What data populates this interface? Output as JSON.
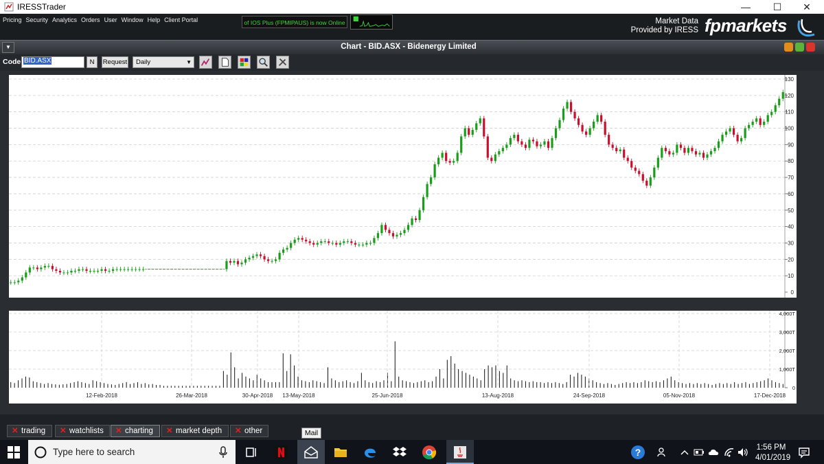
{
  "window": {
    "title": "IRESSTrader",
    "minimize": "—",
    "maximize": "☐",
    "close": "✕"
  },
  "menu": [
    "Pricing",
    "Security",
    "Analytics",
    "Orders",
    "User",
    "Window",
    "Help",
    "Client Portal"
  ],
  "status": {
    "online_text": "of IOS Plus (FPMIPAUS) is now Online"
  },
  "branding": {
    "market_data_line1": "Market Data",
    "market_data_line2": "Provided by IRESS",
    "brand": "fpmarkets"
  },
  "chart_window": {
    "title": "Chart - BID.ASX - Bidenergy Limited",
    "menu_glyph": "▼"
  },
  "toolbar": {
    "code_label": "Code:",
    "code_value": "BID.ASX",
    "n_button": "N",
    "request_button": "Request",
    "period": "Daily",
    "period_arrow": "▼"
  },
  "chart_data": [
    {
      "type": "candlestick",
      "x_tick_labels": [
        "12-Feb-2018",
        "26-Mar-2018",
        "30-Apr-2018",
        "13-May-2018",
        "25-Jun-2018",
        "13-Aug-2018",
        "24-Sep-2018",
        "05-Nov-2018",
        "17-Dec-2018"
      ],
      "y_tick_labels": [
        "0",
        "10",
        "20",
        "30",
        "40",
        "50",
        "60",
        "70",
        "80",
        "90",
        "100",
        "110",
        "120",
        "130"
      ],
      "ylim": [
        0,
        130
      ],
      "grid": true,
      "close_series_approx": [
        6,
        6,
        7,
        9,
        12,
        15,
        15,
        14,
        15,
        16,
        16,
        14,
        13,
        12,
        12,
        12,
        13,
        13,
        14,
        14,
        13,
        13,
        13,
        13,
        14,
        13,
        13,
        14,
        14,
        14,
        14,
        14,
        14,
        14,
        14,
        14,
        14,
        14,
        14,
        14,
        14,
        14,
        14,
        14,
        14,
        14,
        14,
        14,
        14,
        14,
        14,
        14,
        14,
        14,
        14,
        14,
        14,
        19,
        18,
        19,
        17,
        18,
        20,
        21,
        22,
        23,
        22,
        20,
        19,
        19,
        20,
        24,
        26,
        27,
        30,
        32,
        33,
        32,
        31,
        30,
        29,
        30,
        31,
        31,
        30,
        30,
        29,
        30,
        31,
        31,
        30,
        29,
        29,
        29,
        30,
        30,
        33,
        36,
        41,
        38,
        36,
        34,
        35,
        36,
        38,
        41,
        45,
        44,
        50,
        58,
        66,
        70,
        78,
        82,
        85,
        80,
        79,
        80,
        85,
        95,
        100,
        96,
        99,
        103,
        106,
        95,
        82,
        80,
        84,
        86,
        88,
        90,
        94,
        96,
        92,
        90,
        88,
        93,
        92,
        89,
        90,
        92,
        88,
        94,
        100,
        105,
        112,
        116,
        110,
        106,
        102,
        98,
        96,
        100,
        104,
        108,
        104,
        96,
        90,
        88,
        86,
        87,
        82,
        80,
        76,
        74,
        72,
        68,
        65,
        70,
        76,
        82,
        88,
        86,
        84,
        85,
        90,
        88,
        85,
        88,
        86,
        84,
        85,
        82,
        84,
        86,
        88,
        92,
        96,
        98,
        100,
        96,
        92,
        94,
        100,
        102,
        104,
        106,
        102,
        104,
        108,
        110,
        114,
        118,
        122
      ]
    },
    {
      "type": "bar",
      "name": "volume",
      "y_tick_labels": [
        "0",
        "1,000T",
        "2,000T",
        "3,000T",
        "4,000T"
      ],
      "ylim": [
        0,
        4000
      ],
      "note_unit": "T",
      "values_approx": [
        300,
        250,
        400,
        500,
        600,
        550,
        350,
        300,
        250,
        200,
        250,
        200,
        180,
        160,
        180,
        200,
        250,
        300,
        350,
        300,
        250,
        200,
        400,
        350,
        300,
        250,
        200,
        180,
        150,
        200,
        250,
        300,
        200,
        250,
        300,
        200,
        250,
        180,
        200,
        150,
        150,
        100,
        100,
        100,
        100,
        100,
        100,
        100,
        100,
        100,
        100,
        100,
        100,
        100,
        100,
        100,
        100,
        900,
        700,
        1900,
        1100,
        500,
        800,
        600,
        500,
        400,
        700,
        500,
        400,
        300,
        300,
        300,
        300,
        1850,
        900,
        1800,
        1200,
        600,
        400,
        350,
        300,
        400,
        350,
        300,
        250,
        1100,
        500,
        400,
        300,
        350,
        400,
        300,
        250,
        350,
        800,
        400,
        300,
        250,
        350,
        300,
        400,
        800,
        350,
        2500,
        600,
        400,
        350,
        300,
        250,
        300,
        350,
        400,
        300,
        350,
        600,
        1000,
        500,
        1500,
        1700,
        1300,
        1000,
        900,
        800,
        700,
        600,
        500,
        400,
        1000,
        1200,
        1100,
        1200,
        900,
        800,
        1200,
        500,
        400,
        350,
        400,
        350,
        300,
        350,
        300,
        300,
        250,
        300,
        250,
        300,
        250,
        200,
        300,
        700,
        600,
        800,
        700,
        600,
        500,
        400,
        300,
        250,
        200,
        250,
        200,
        150,
        200,
        250,
        300,
        250,
        300,
        250,
        300,
        400,
        350,
        300,
        350,
        300,
        400,
        500,
        600,
        400,
        300,
        250,
        200,
        250,
        200,
        250,
        200,
        250,
        200,
        150,
        200,
        250,
        200,
        250,
        200,
        300,
        200,
        250,
        300,
        200,
        250,
        300,
        350,
        400,
        500,
        400,
        300,
        250,
        200
      ]
    }
  ],
  "tabs": [
    {
      "label": "trading",
      "x": "✕"
    },
    {
      "label": "watchlists",
      "x": "✕"
    },
    {
      "label": "charting",
      "x": "✕"
    },
    {
      "label": "market depth",
      "x": "✕"
    },
    {
      "label": "other",
      "x": "✕"
    }
  ],
  "tooltip": "Mail",
  "taskbar": {
    "search_placeholder": "Type here to search",
    "time": "1:56 PM",
    "date": "4/01/2019"
  },
  "colors": {
    "up": "#1a9e1a",
    "down": "#c8102e",
    "accent": "#3366cc"
  }
}
